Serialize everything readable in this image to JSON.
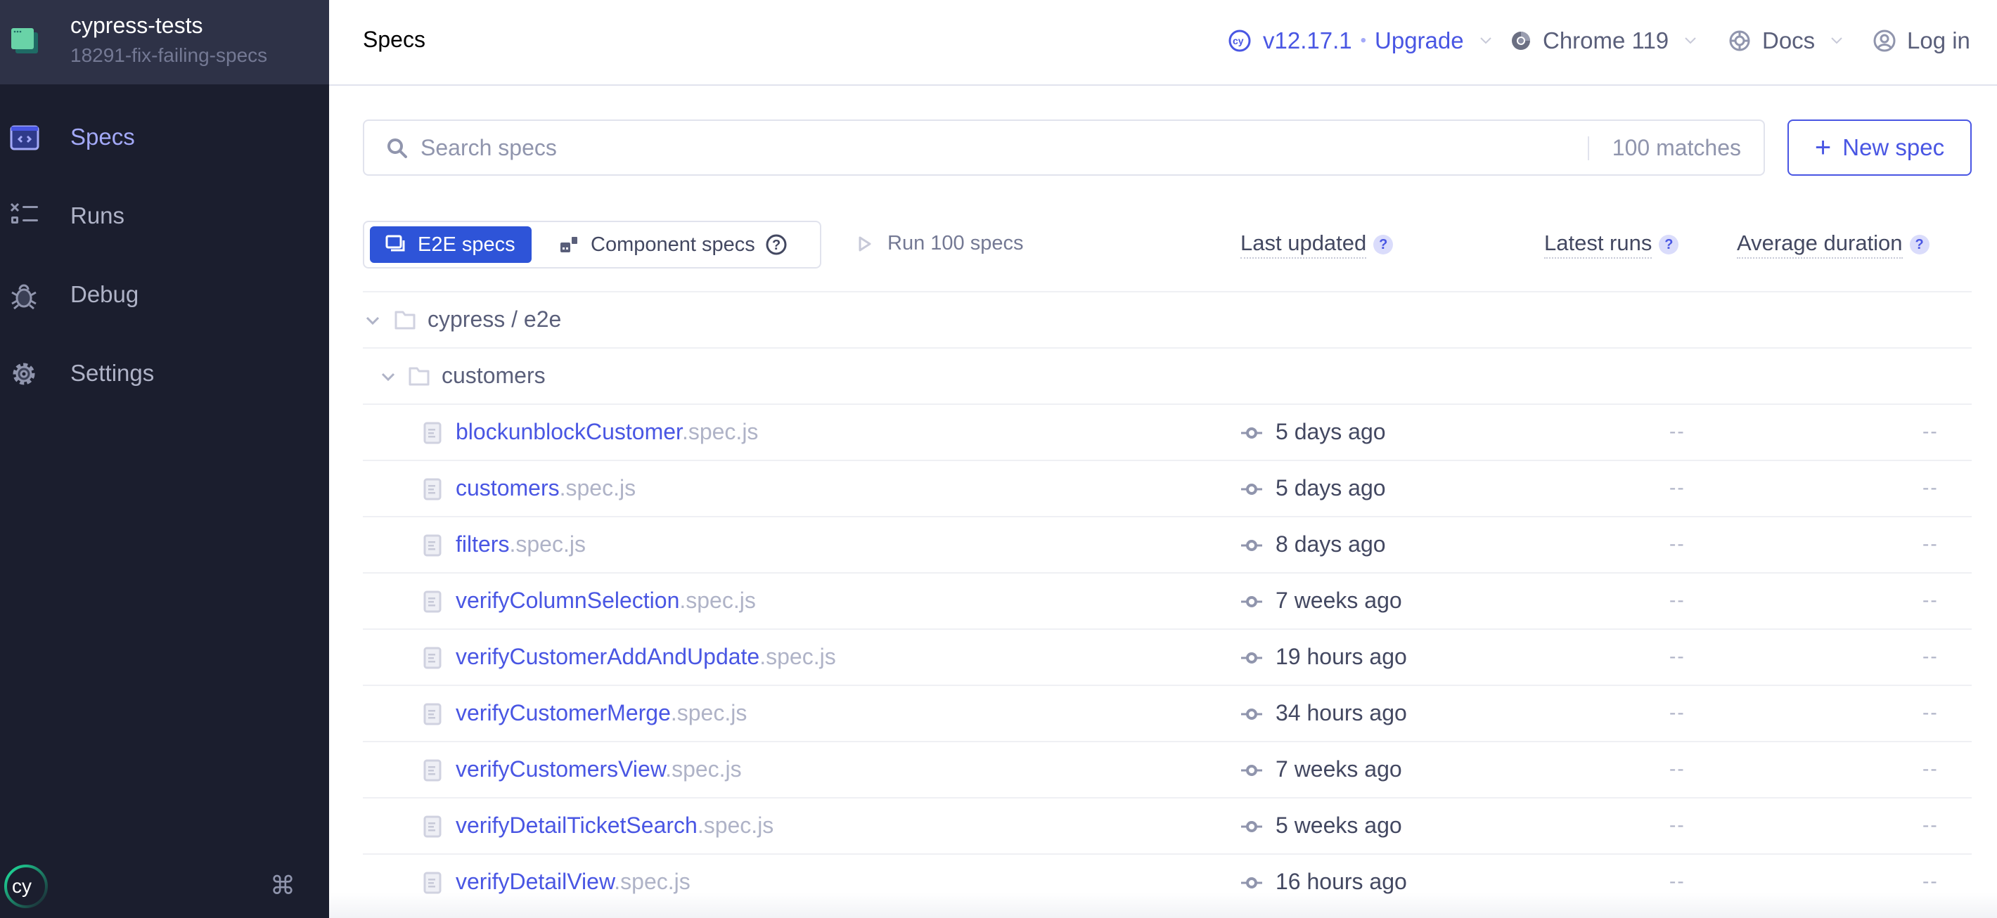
{
  "project": {
    "name": "cypress-tests",
    "branch": "18291-fix-failing-specs"
  },
  "sidebar": {
    "items": [
      {
        "label": "Specs",
        "icon": "code-window-icon",
        "active": true
      },
      {
        "label": "Runs",
        "icon": "runs-list-icon",
        "active": false
      },
      {
        "label": "Debug",
        "icon": "bug-icon",
        "active": false
      },
      {
        "label": "Settings",
        "icon": "gear-icon",
        "active": false
      }
    ],
    "footer": {
      "logo": "cypress-logo",
      "shortcut_icon": "command-key-icon",
      "shortcut_glyph": "⌘"
    }
  },
  "header": {
    "title": "Specs",
    "version": "v12.17.1",
    "version_separator": "•",
    "upgrade_label": "Upgrade",
    "browser": "Chrome 119",
    "docs": "Docs",
    "login": "Log in"
  },
  "search": {
    "placeholder": "Search specs",
    "value": "",
    "matches": "100 matches"
  },
  "new_spec_button": {
    "plus": "+",
    "label": "New spec"
  },
  "spec_type_toggle": {
    "options": [
      {
        "label": "E2E specs",
        "selected": true
      },
      {
        "label": "Component specs",
        "selected": false
      }
    ],
    "help": "?"
  },
  "run_all": {
    "label": "Run 100 specs"
  },
  "columns": {
    "last_updated": "Last updated",
    "latest_runs": "Latest runs",
    "average_duration": "Average duration",
    "help": "?"
  },
  "tree": {
    "folders": [
      {
        "name": "cypress / e2e",
        "expanded": true
      },
      {
        "name": "customers",
        "expanded": true
      }
    ],
    "specs": [
      {
        "base": "blockunblockCustomer",
        "ext": ".spec.js",
        "last_updated": "5 days ago",
        "latest_runs": "--",
        "average_duration": "--"
      },
      {
        "base": "customers",
        "ext": ".spec.js",
        "last_updated": "5 days ago",
        "latest_runs": "--",
        "average_duration": "--"
      },
      {
        "base": "filters",
        "ext": ".spec.js",
        "last_updated": "8 days ago",
        "latest_runs": "--",
        "average_duration": "--"
      },
      {
        "base": "verifyColumnSelection",
        "ext": ".spec.js",
        "last_updated": "7 weeks ago",
        "latest_runs": "--",
        "average_duration": "--"
      },
      {
        "base": "verifyCustomerAddAndUpdate",
        "ext": ".spec.js",
        "last_updated": "19 hours ago",
        "latest_runs": "--",
        "average_duration": "--"
      },
      {
        "base": "verifyCustomerMerge",
        "ext": ".spec.js",
        "last_updated": "34 hours ago",
        "latest_runs": "--",
        "average_duration": "--"
      },
      {
        "base": "verifyCustomersView",
        "ext": ".spec.js",
        "last_updated": "7 weeks ago",
        "latest_runs": "--",
        "average_duration": "--"
      },
      {
        "base": "verifyDetailTicketSearch",
        "ext": ".spec.js",
        "last_updated": "5 weeks ago",
        "latest_runs": "--",
        "average_duration": "--"
      },
      {
        "base": "verifyDetailView",
        "ext": ".spec.js",
        "last_updated": "16 hours ago",
        "latest_runs": "--",
        "average_duration": "--"
      }
    ]
  },
  "colors": {
    "sidebar_bg": "#1b1e2e",
    "project_bg": "#2e3247",
    "accent": "#4956e3",
    "active_nav": "#a3a9f8",
    "toggle_selected": "#2e54d8",
    "project_icon": "#69d3a7"
  }
}
